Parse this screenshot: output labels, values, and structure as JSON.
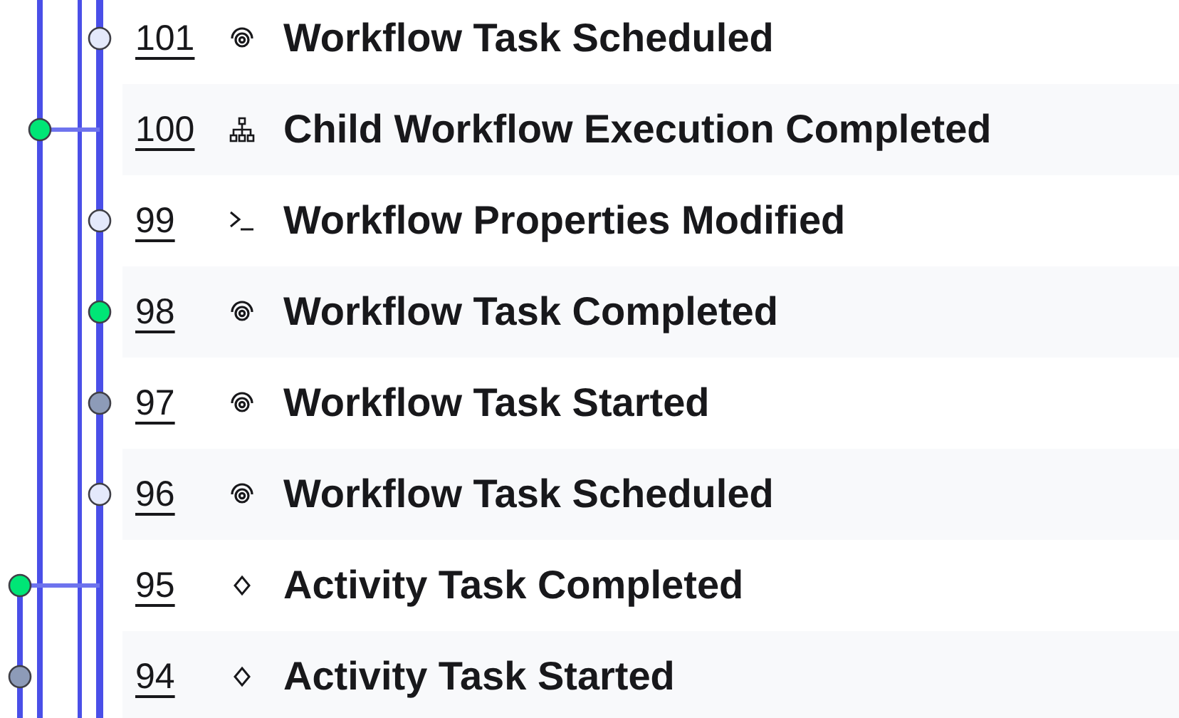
{
  "events": [
    {
      "id": "101",
      "title": "Workflow Task Scheduled",
      "kind": "workflow-task",
      "dot": {
        "kind": "main",
        "color": "#e4e9fb"
      }
    },
    {
      "id": "100",
      "title": "Child Workflow Execution Completed",
      "kind": "child-workflow",
      "dot": {
        "kind": "child",
        "color": "#00e676"
      }
    },
    {
      "id": "99",
      "title": "Workflow Properties Modified",
      "kind": "properties",
      "dot": {
        "kind": "main",
        "color": "#e4e9fb"
      }
    },
    {
      "id": "98",
      "title": "Workflow Task Completed",
      "kind": "workflow-task",
      "dot": {
        "kind": "main",
        "color": "#00e676"
      }
    },
    {
      "id": "97",
      "title": "Workflow Task Started",
      "kind": "workflow-task",
      "dot": {
        "kind": "main",
        "color": "#8d9bb8"
      }
    },
    {
      "id": "96",
      "title": "Workflow Task Scheduled",
      "kind": "workflow-task",
      "dot": {
        "kind": "main",
        "color": "#e4e9fb"
      }
    },
    {
      "id": "95",
      "title": "Activity Task Completed",
      "kind": "activity",
      "dot": {
        "kind": "branch",
        "color": "#00e676"
      }
    },
    {
      "id": "94",
      "title": "Activity Task Started",
      "kind": "activity",
      "dot": {
        "kind": "lane",
        "color": "#8d9bb8"
      }
    }
  ]
}
